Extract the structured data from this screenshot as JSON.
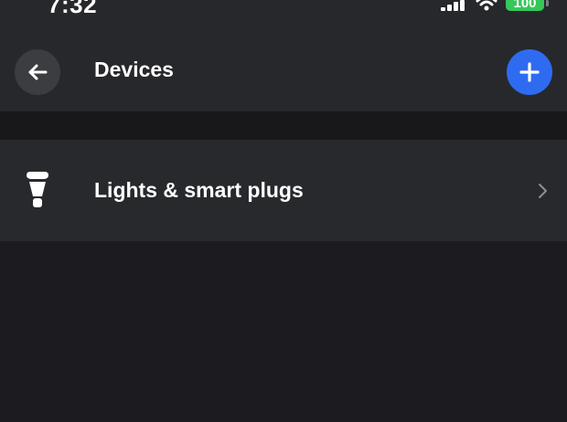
{
  "status_bar": {
    "time": "7:32",
    "battery": "100",
    "signal_icon": "cellular-signal-icon",
    "wifi_icon": "wifi-icon"
  },
  "header": {
    "title": "Devices",
    "back_icon": "arrow-left-icon",
    "add_icon": "plus-icon"
  },
  "devices": {
    "items": [
      {
        "label": "Lights & smart plugs",
        "icon": "smart-bulb-icon",
        "chevron": "chevron-right-icon"
      }
    ]
  },
  "colors": {
    "header_bg": "#27282c",
    "page_bg": "#1c1c20",
    "row_bg": "#28292d",
    "accent": "#2f6bf1",
    "battery": "#35c759"
  }
}
